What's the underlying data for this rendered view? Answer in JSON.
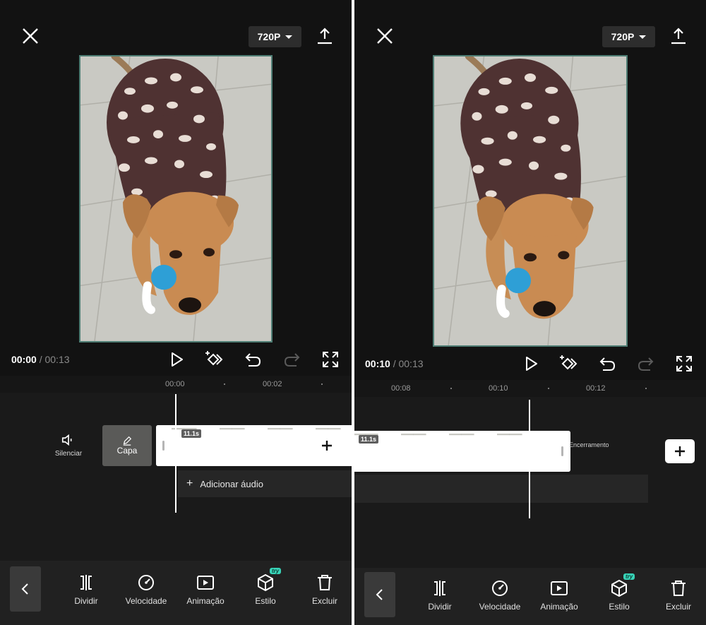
{
  "left": {
    "resolution": "720P",
    "time_current": "00:00",
    "time_separator": "/",
    "time_total": "00:13",
    "ruler": [
      {
        "label": "00:00"
      },
      {
        "label": "00:02"
      }
    ],
    "mute_label": "Silenciar",
    "cover_label": "Capa",
    "clip_duration": "11.1s",
    "add_audio_label": "Adicionar áudio"
  },
  "right": {
    "resolution": "720P",
    "time_current": "00:10",
    "time_separator": "/",
    "time_total": "00:13",
    "ruler": [
      {
        "label": "00:08"
      },
      {
        "label": "00:10"
      },
      {
        "label": "00:12"
      }
    ],
    "clip_duration": "11.1s",
    "ending_label": "Encerramento"
  },
  "toolbar": {
    "items": [
      {
        "label": "Dividir",
        "icon": "split-icon"
      },
      {
        "label": "Velocidade",
        "icon": "speed-icon"
      },
      {
        "label": "Animação",
        "icon": "animation-icon"
      },
      {
        "label": "Estilo",
        "icon": "style-cube-icon",
        "badge": "try"
      },
      {
        "label": "Excluir",
        "icon": "trash-icon"
      }
    ]
  },
  "colors": {
    "background": "#121212",
    "timeline": "#1a1a1a",
    "toolbar": "#212121",
    "try_badge": "#38d4b8",
    "preview_border": "#4e7d74"
  }
}
